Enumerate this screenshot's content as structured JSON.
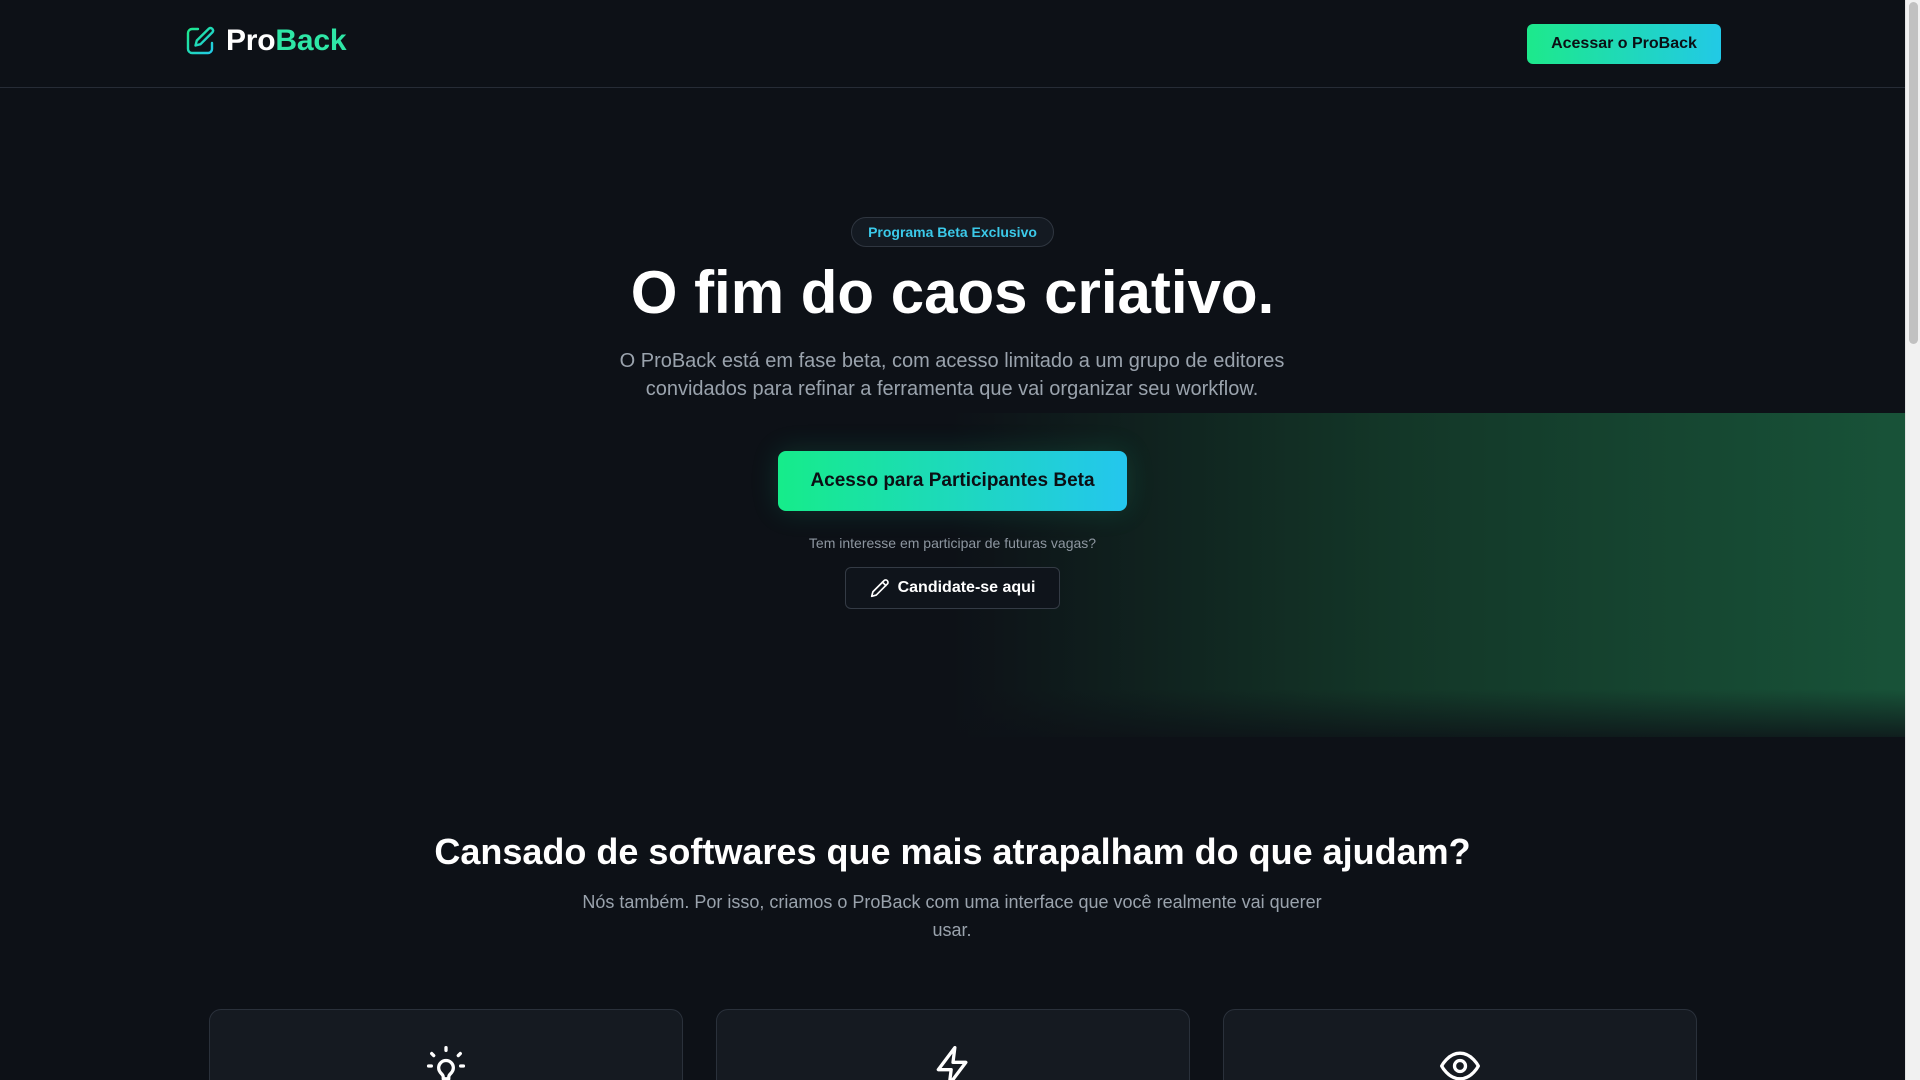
{
  "header": {
    "logo": {
      "icon": "edit-square-icon",
      "part1": "Pro",
      "part2": "Back"
    },
    "cta_label": "Acessar o ProBack"
  },
  "hero": {
    "badge": "Programa Beta Exclusivo",
    "title": "O fim do caos criativo.",
    "subtitle": "O ProBack está em fase beta, com acesso limitado a um grupo de editores convidados para refinar a ferramenta que vai organizar seu workflow.",
    "cta_label": "Acesso para Participantes Beta",
    "note": "Tem interesse em participar de futuras vagas?",
    "apply_label": "Candidate-se aqui",
    "apply_icon": "pencil-icon"
  },
  "features": {
    "title": "Cansado de softwares que mais atrapalham do que ajudam?",
    "subtitle": "Nós também. Por isso, criamos o ProBack com uma interface que você realmente vai querer usar.",
    "cards": [
      {
        "icon": "lightbulb-icon"
      },
      {
        "icon": "lightning-icon"
      },
      {
        "icon": "eye-icon"
      }
    ]
  },
  "colors": {
    "background": "#0d1117",
    "accent_green": "#1de98b",
    "accent_cyan": "#22c9e6",
    "muted_text": "#9aa3ad"
  }
}
